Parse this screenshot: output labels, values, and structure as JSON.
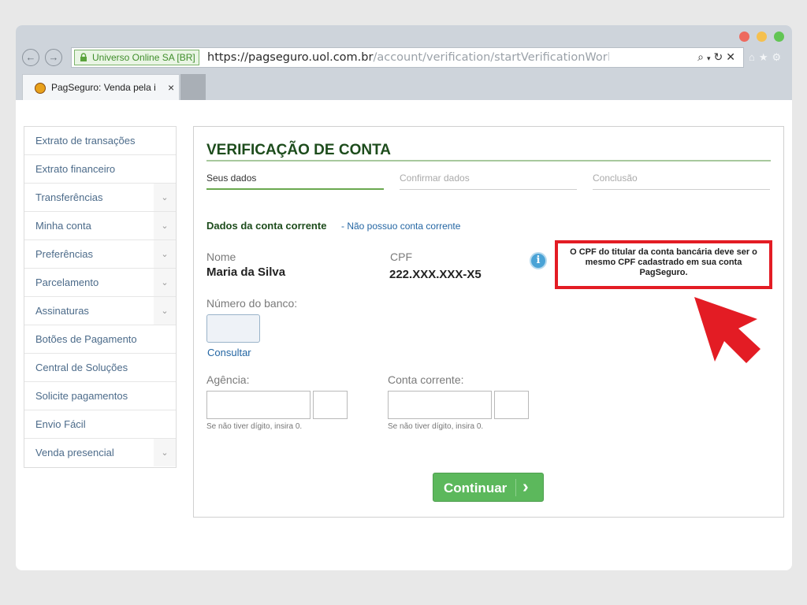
{
  "browser": {
    "secure_label": "Universo Online SA [BR]",
    "url_scheme": "https://",
    "url_host": "pagseguro.uol.com.br",
    "url_path": "/account/verification/startVerificationWor",
    "url_fade": "k",
    "tab_title": "PagSeguro: Venda pela in",
    "tab_close": "×"
  },
  "sidebar": {
    "items": [
      {
        "label": "Extrato de transações"
      },
      {
        "label": "Extrato financeiro"
      },
      {
        "label": "Transferências"
      },
      {
        "label": "Minha conta"
      },
      {
        "label": "Preferências"
      },
      {
        "label": "Parcelamento"
      },
      {
        "label": "Assinaturas"
      },
      {
        "label": "Botões de Pagamento"
      },
      {
        "label": "Central de Soluções"
      },
      {
        "label": "Solicite pagamentos"
      },
      {
        "label": "Envio Fácil"
      },
      {
        "label": "Venda presencial"
      }
    ]
  },
  "panel": {
    "title": "VERIFICAÇÃO DE CONTA",
    "steps": [
      "Seus dados",
      "Confirmar dados",
      "Conclusão"
    ],
    "section_title": "Dados da conta corrente",
    "no_account_link": "- Não possuo conta corrente",
    "name_label": "Nome",
    "name_value": "Maria da Silva",
    "cpf_label": "CPF",
    "cpf_value": "222.XXX.XXX-X5",
    "info_icon_text": "i",
    "tip": "O CPF do titular da conta bancária deve ser o mesmo CPF cadastrado em sua conta PagSeguro.",
    "bank_label": "Número do banco:",
    "consult_link": "Consultar",
    "agency_label": "Agência:",
    "agency_hint": "Se não tiver dígito, insira 0.",
    "account_label": "Conta corrente:",
    "account_hint": "Se não tiver dígito, insira 0.",
    "continue_label": "Continuar",
    "continue_arrow": "›"
  },
  "colors": {
    "accent_green": "#5cb85c",
    "title_green": "#1d4c1c",
    "link_blue": "#2466a3",
    "highlight_red": "#e31c24"
  }
}
